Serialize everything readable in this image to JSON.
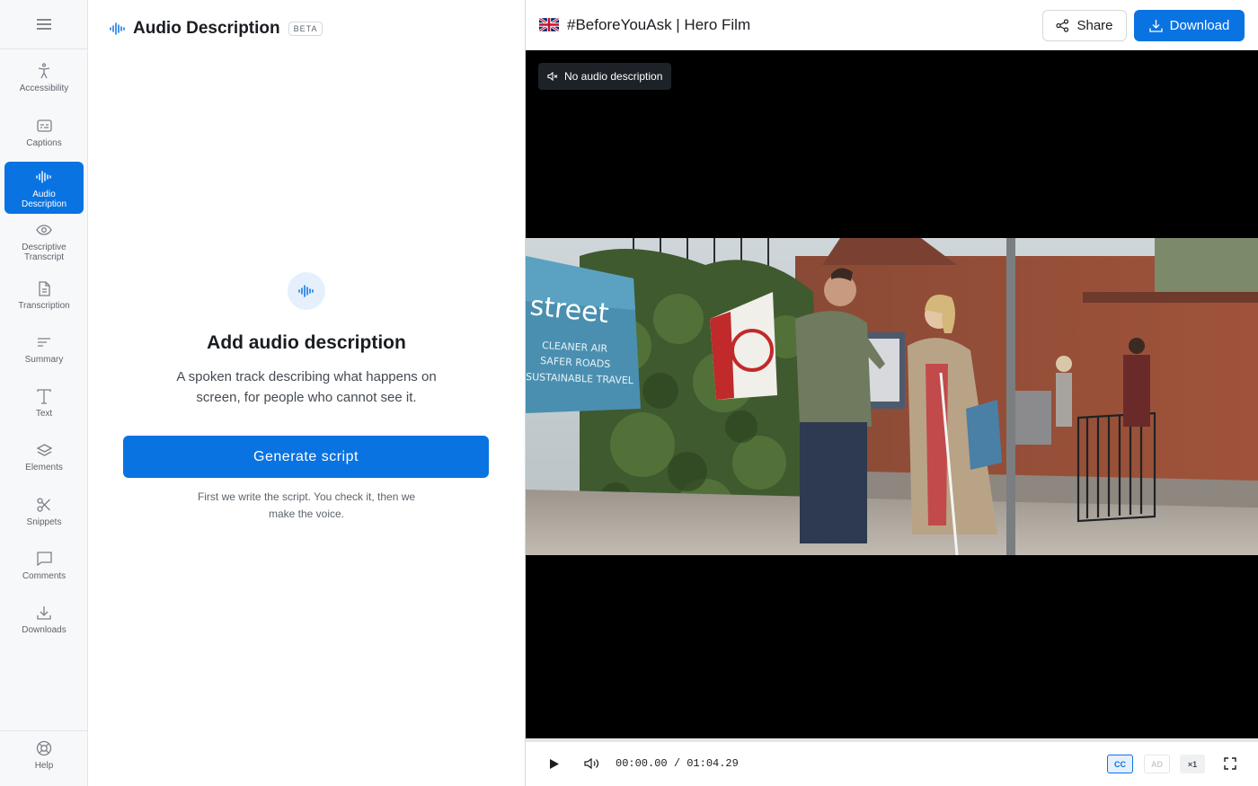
{
  "rail": {
    "menu_icon": "hamburger-menu-icon",
    "items": [
      {
        "label": "Accessibility",
        "icon": "person-accessibility-icon"
      },
      {
        "label": "Captions",
        "icon": "captions-icon"
      },
      {
        "label": "Audio Description",
        "icon": "audio-waveform-icon",
        "active": true
      },
      {
        "label": "Descriptive Transcript",
        "icon": "eye-icon"
      },
      {
        "label": "Transcription",
        "icon": "document-icon"
      },
      {
        "label": "Summary",
        "icon": "lines-icon"
      },
      {
        "label": "Text",
        "icon": "text-t-icon"
      },
      {
        "label": "Elements",
        "icon": "layers-icon"
      },
      {
        "label": "Snippets",
        "icon": "scissors-icon"
      },
      {
        "label": "Comments",
        "icon": "comment-icon"
      },
      {
        "label": "Downloads",
        "icon": "download-tray-icon"
      }
    ],
    "help": {
      "label": "Help",
      "icon": "lifebuoy-icon"
    }
  },
  "panel": {
    "title": "Audio Description",
    "badge": "BETA",
    "empty_title": "Add audio description",
    "empty_text": "A spoken track describing what happens on screen, for people who cannot see it.",
    "generate_label": "Generate script",
    "note": "First we write the script. You check it, then we make the voice."
  },
  "viewer": {
    "title": "#BeforeYouAsk | Hero Film",
    "share_label": "Share",
    "download_label": "Download",
    "ad_status": "No audio description",
    "frame_sign_text": "street",
    "frame_sign_lines": [
      "CLEANER AIR",
      "SAFER ROADS",
      "SUSTAINABLE TRAVEL"
    ],
    "time_current": "00:00.00",
    "time_separator": "/",
    "time_total": "01:04.29",
    "cc_label": "CC",
    "ad_label": "AD",
    "speed_label": "×1",
    "progress": 0
  },
  "colors": {
    "accent": "#0a73e2",
    "accent_soft": "#e5f0fc"
  }
}
